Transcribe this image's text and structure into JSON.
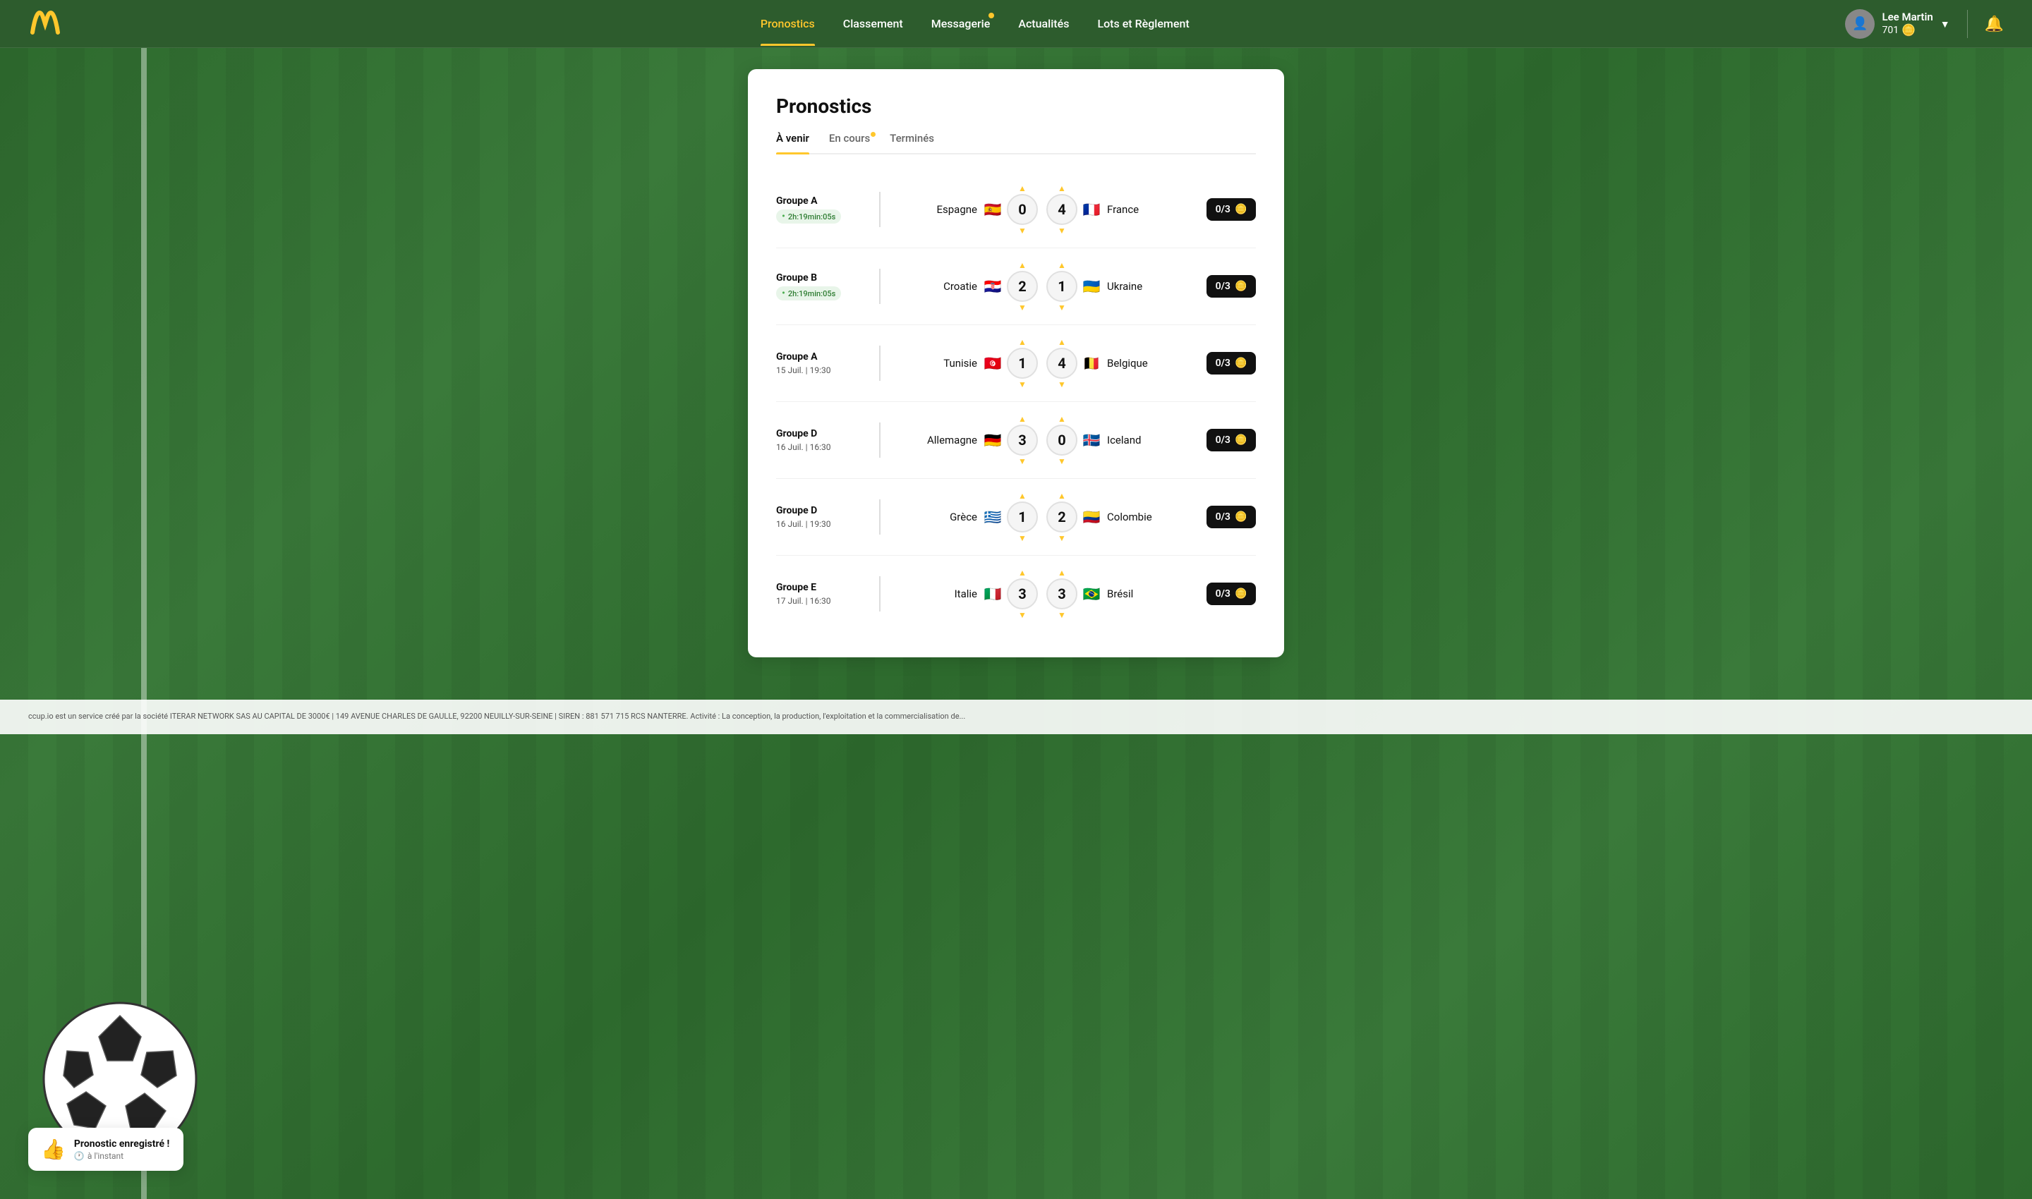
{
  "nav": {
    "links": [
      {
        "label": "Pronostics",
        "active": true,
        "dot": false
      },
      {
        "label": "Classement",
        "active": false,
        "dot": false
      },
      {
        "label": "Messagerie",
        "active": false,
        "dot": true
      },
      {
        "label": "Actualités",
        "active": false,
        "dot": false
      },
      {
        "label": "Lots et Règlement",
        "active": false,
        "dot": false
      }
    ],
    "user": {
      "name": "Lee Martin",
      "coins": "701",
      "coin_symbol": "🪙"
    }
  },
  "page": {
    "title": "Pronostics",
    "tabs": [
      {
        "label": "À venir",
        "active": true,
        "dot": false
      },
      {
        "label": "En cours",
        "active": false,
        "dot": true
      },
      {
        "label": "Terminés",
        "active": false,
        "dot": false
      }
    ]
  },
  "matches": [
    {
      "group": "Groupe A",
      "time": "2h:19min:05s",
      "live": true,
      "team_home": "Espagne",
      "flag_home": "🇪🇸",
      "score_home": "0",
      "score_away": "4",
      "team_away": "France",
      "flag_away": "🇫🇷",
      "points": "0/3",
      "coin": "🪙"
    },
    {
      "group": "Groupe B",
      "time": "2h:19min:05s",
      "live": true,
      "team_home": "Croatie",
      "flag_home": "🇭🇷",
      "score_home": "2",
      "score_away": "1",
      "team_away": "Ukraine",
      "flag_away": "🇺🇦",
      "points": "0/3",
      "coin": "🪙"
    },
    {
      "group": "Groupe A",
      "time": "15 Juil. | 19:30",
      "live": false,
      "team_home": "Tunisie",
      "flag_home": "🇹🇳",
      "score_home": "1",
      "score_away": "4",
      "team_away": "Belgique",
      "flag_away": "🇧🇪",
      "points": "0/3",
      "coin": "🪙"
    },
    {
      "group": "Groupe D",
      "time": "16 Juil. | 16:30",
      "live": false,
      "team_home": "Allemagne",
      "flag_home": "🇩🇪",
      "score_home": "3",
      "score_away": "0",
      "team_away": "Iceland",
      "flag_away": "🇮🇸",
      "points": "0/3",
      "coin": "🪙"
    },
    {
      "group": "Groupe D",
      "time": "16 Juil. | 19:30",
      "live": false,
      "team_home": "Grèce",
      "flag_home": "🇬🇷",
      "score_home": "1",
      "score_away": "2",
      "team_away": "Colombie",
      "flag_away": "🇨🇴",
      "points": "0/3",
      "coin": "🪙"
    },
    {
      "group": "Groupe E",
      "time": "17 Juil. | 16:30",
      "live": false,
      "team_home": "Italie",
      "flag_home": "🇮🇹",
      "score_home": "3",
      "score_away": "3",
      "team_away": "Brésil",
      "flag_away": "🇧🇷",
      "points": "0/3",
      "coin": "🪙"
    }
  ],
  "toast": {
    "icon": "👍",
    "title": "Pronostic enregistré !",
    "subtitle": "à l'instant",
    "subtitle_icon": "🕐"
  },
  "footer": {
    "text": "ccup.io est un service créé par la société ITERAR NETWORK SAS AU CAPITAL DE 3000€ | 149 AVENUE CHARLES DE GAULLE, 92200 NEUILLY-SUR-SEINE | SIREN : 881 571 715 RCS NANTERRE. Activité : La conception, la production, l'exploitation et la commercialisation de..."
  }
}
